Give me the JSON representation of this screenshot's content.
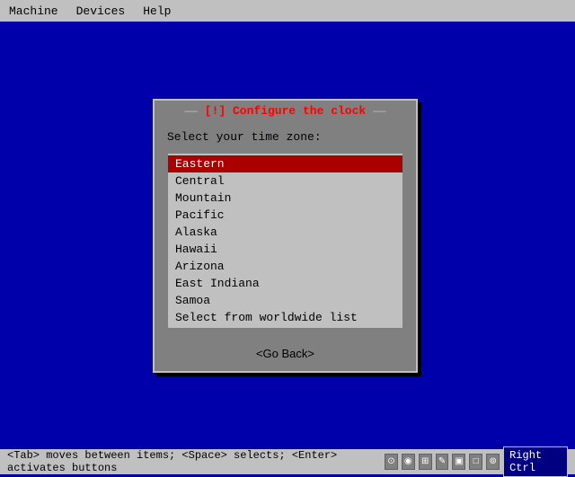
{
  "menubar": {
    "items": [
      {
        "id": "machine",
        "label": "Machine"
      },
      {
        "id": "devices",
        "label": "Devices"
      },
      {
        "id": "help",
        "label": "Help"
      }
    ]
  },
  "dialog": {
    "title": "[!] Configure the clock",
    "title_prefix": "—",
    "title_suffix": "—",
    "prompt": "Select your time zone:",
    "timezones": [
      {
        "id": "eastern",
        "label": "Eastern",
        "selected": true
      },
      {
        "id": "central",
        "label": "Central",
        "selected": false
      },
      {
        "id": "mountain",
        "label": "Mountain",
        "selected": false
      },
      {
        "id": "pacific",
        "label": "Pacific",
        "selected": false
      },
      {
        "id": "alaska",
        "label": "Alaska",
        "selected": false
      },
      {
        "id": "hawaii",
        "label": "Hawaii",
        "selected": false
      },
      {
        "id": "arizona",
        "label": "Arizona",
        "selected": false
      },
      {
        "id": "east-indiana",
        "label": "East Indiana",
        "selected": false
      },
      {
        "id": "samoa",
        "label": "Samoa",
        "selected": false
      },
      {
        "id": "worldwide",
        "label": "Select from worldwide list",
        "selected": false
      }
    ],
    "go_back_label": "<Go Back>"
  },
  "statusbar": {
    "hint": "<Tab> moves between items; <Space> selects; <Enter> activates buttons",
    "right_ctrl_label": "Right Ctrl"
  }
}
